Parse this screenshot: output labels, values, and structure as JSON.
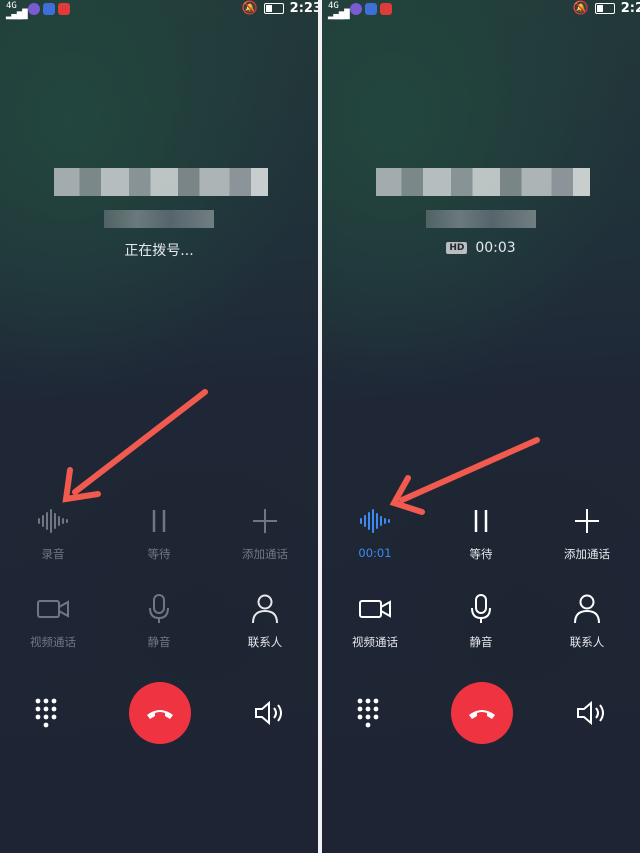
{
  "left": {
    "status_bar": {
      "network": "4G",
      "time": "2:23"
    },
    "call_status": "正在拨号...",
    "actions_row1": [
      {
        "label": "录音",
        "icon": "waveform-icon"
      },
      {
        "label": "等待",
        "icon": "pause-icon"
      },
      {
        "label": "添加通话",
        "icon": "plus-icon"
      }
    ],
    "actions_row2": [
      {
        "label": "视频通话",
        "icon": "video-camera-icon"
      },
      {
        "label": "静音",
        "icon": "microphone-icon"
      },
      {
        "label": "联系人",
        "icon": "person-icon"
      }
    ]
  },
  "right": {
    "status_bar": {
      "network": "4G",
      "time": "2:2"
    },
    "hd_badge": "HD",
    "call_duration": "00:03",
    "actions_row1": [
      {
        "label": "00:01",
        "icon": "waveform-icon"
      },
      {
        "label": "等待",
        "icon": "pause-icon"
      },
      {
        "label": "添加通话",
        "icon": "plus-icon"
      }
    ],
    "actions_row2": [
      {
        "label": "视频通话",
        "icon": "video-camera-icon"
      },
      {
        "label": "静音",
        "icon": "microphone-icon"
      },
      {
        "label": "联系人",
        "icon": "person-icon"
      }
    ]
  },
  "colors": {
    "end_call": "#ef3340",
    "recording_active": "#3d8bf2",
    "annotation_arrow": "#f05a4f",
    "dim_label": "#6f7785"
  }
}
